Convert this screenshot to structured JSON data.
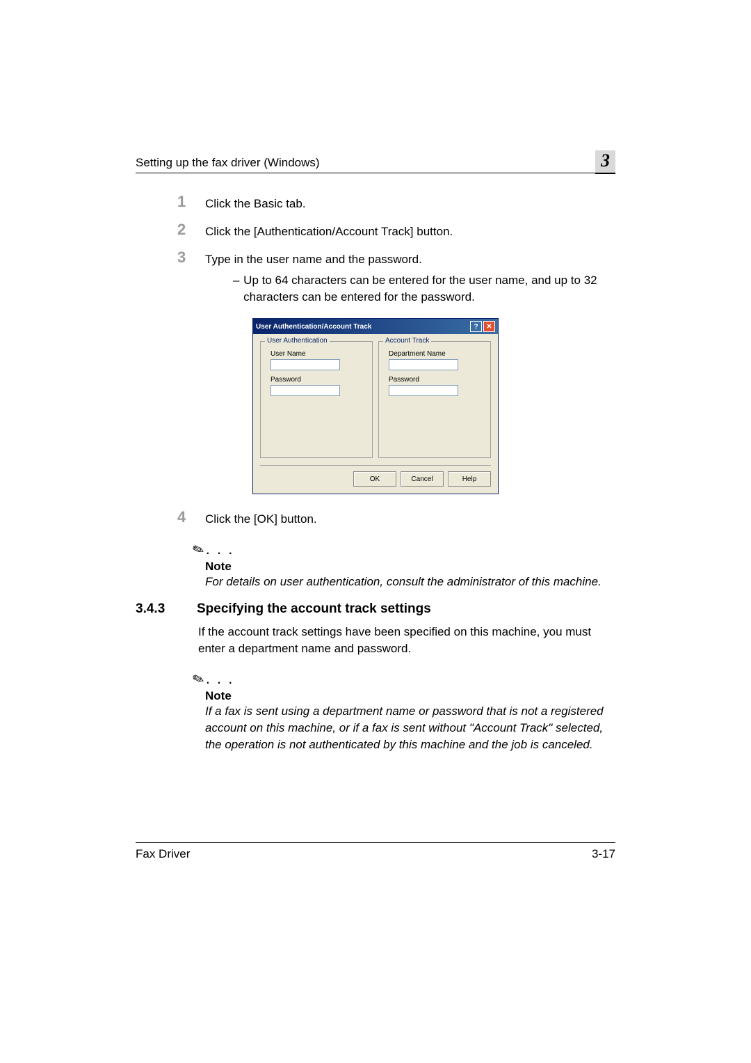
{
  "header": {
    "title": "Setting up the fax driver (Windows)",
    "chapter": "3"
  },
  "steps": {
    "s1": {
      "num": "1",
      "text": "Click the Basic tab."
    },
    "s2": {
      "num": "2",
      "text": "Click the [Authentication/Account Track] button."
    },
    "s3": {
      "num": "3",
      "text": "Type in the user name and the password.",
      "sub": "Up to 64 characters can be entered for the user name, and up to 32 characters can be entered for the password."
    },
    "s4": {
      "num": "4",
      "text": "Click the [OK] button."
    }
  },
  "dialog": {
    "title": "User Authentication/Account Track",
    "group1": {
      "legend": "User Authentication",
      "label1": "User Name",
      "label2": "Password"
    },
    "group2": {
      "legend": "Account Track",
      "label1": "Department Name",
      "label2": "Password"
    },
    "buttons": {
      "ok": "OK",
      "cancel": "Cancel",
      "help": "Help"
    }
  },
  "note1": {
    "heading": "Note",
    "text": "For details on user authentication, consult the administrator of this machine."
  },
  "section": {
    "num": "3.4.3",
    "title": "Specifying the account track settings",
    "body": "If the account track settings have been specified on this machine, you must enter a department name and password."
  },
  "note2": {
    "heading": "Note",
    "text": "If a fax is sent using a department name or password that is not a registered account on this machine, or if a fax is sent without \"Account Track\" selected, the operation is not authenticated by this machine and the job is canceled."
  },
  "footer": {
    "left": "Fax Driver",
    "right": "3-17"
  }
}
